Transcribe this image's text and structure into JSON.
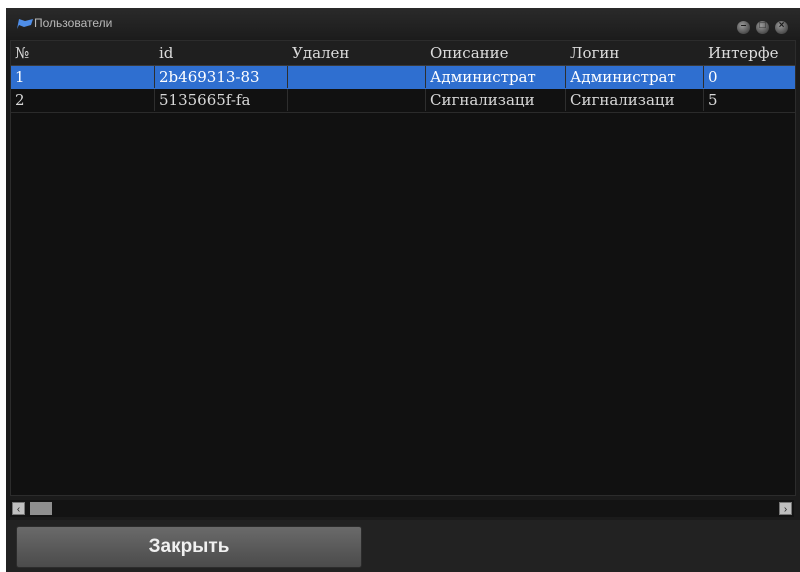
{
  "window": {
    "title": "Пользователи"
  },
  "table": {
    "columns": [
      "№",
      "id",
      "Удален",
      "Описание",
      "Логин",
      "Интерфе"
    ],
    "rows": [
      [
        "1",
        "2b469313-83",
        "",
        "Администрат",
        "Администрат",
        "0"
      ],
      [
        "2",
        "5135665f-fa",
        "",
        "Сигнализаци",
        "Сигнализаци",
        "5"
      ]
    ],
    "selected_row": 0
  },
  "footer": {
    "close_label": "Закрыть"
  },
  "colors": {
    "selection": "#2f6fd0",
    "background": "#111111"
  }
}
